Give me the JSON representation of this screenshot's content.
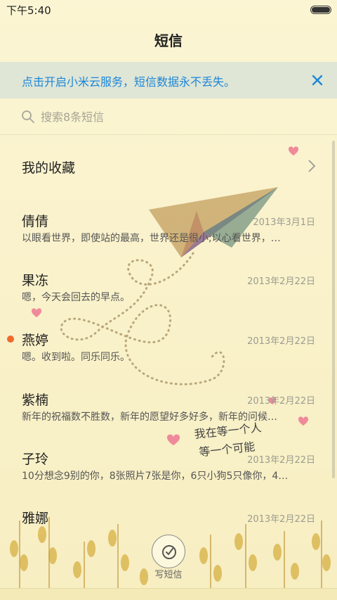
{
  "status_bar": {
    "time": "下午5:40",
    "battery_level": 1.0
  },
  "header": {
    "title": "短信"
  },
  "banner": {
    "text": "点击开启小米云服务，短信数据永不丢失。",
    "accent_color": "#1c86d9"
  },
  "search": {
    "placeholder": "搜索8条短信"
  },
  "favorites": {
    "label": "我的收藏"
  },
  "conversations": [
    {
      "name": "倩倩",
      "date": "2013年3月1日",
      "preview": "以眼看世界，即使站的最高，世界还是很小;以心看世界，…",
      "unread": false
    },
    {
      "name": "果冻",
      "date": "2013年2月22日",
      "preview": "嗯，今天会回去的早点。",
      "unread": false
    },
    {
      "name": "燕婷",
      "date": "2013年2月22日",
      "preview": "嗯。收到啦。同乐同乐。",
      "unread": true
    },
    {
      "name": "紫楠",
      "date": "2013年2月22日",
      "preview": "新年的祝福数不胜数，新年的愿望好多好多，新年的问候…",
      "unread": false
    },
    {
      "name": "子玲",
      "date": "2013年2月22日",
      "preview": "10分想念9别的你，8张照片7张是你，6只小狗5只像你，4…",
      "unread": false
    },
    {
      "name": "雅娜",
      "date": "2013年2月22日",
      "preview": "",
      "unread": false
    }
  ],
  "wallpaper_text": {
    "line1": "我在等一个人",
    "line2": "等一个可能"
  },
  "compose": {
    "label": "写短信"
  },
  "colors": {
    "unread_dot": "#f06a2c",
    "background": "#fbf4cf"
  }
}
